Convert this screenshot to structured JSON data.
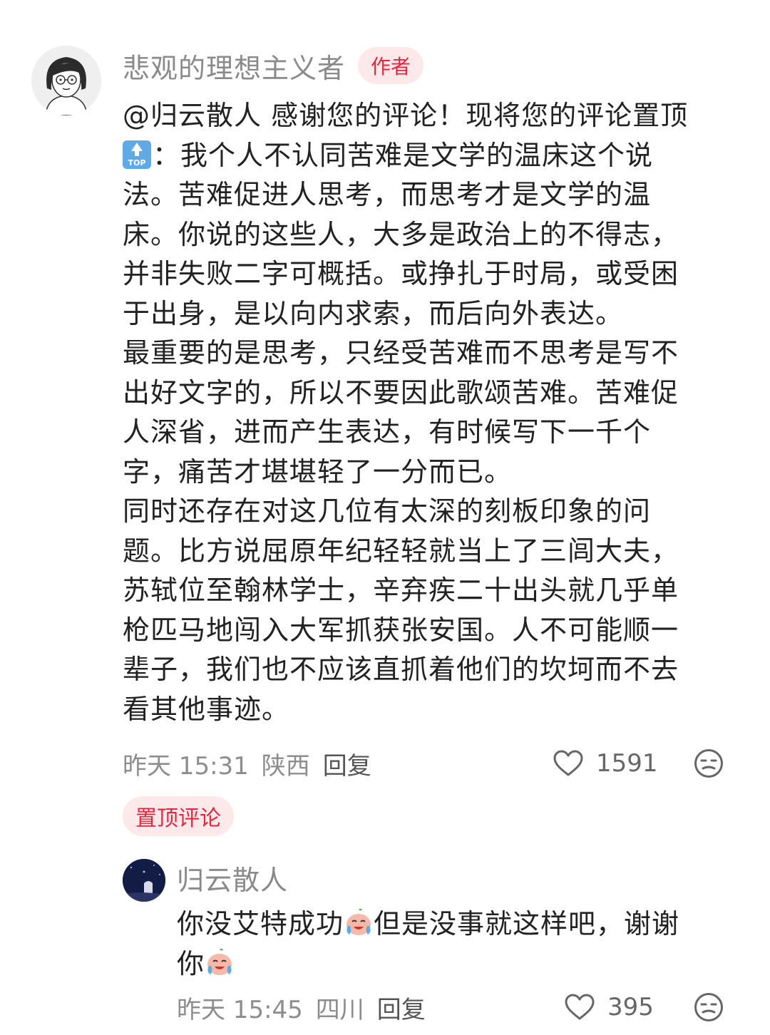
{
  "main_comment": {
    "author": "悲观的理想主义者",
    "author_badge": "作者",
    "avatar_icon": "girl-with-glasses-avatar",
    "text_lines": [
      "@归云散人 感谢您的评论！现将您的评论置顶",
      "：我个人不认同苦难是文学的温床这个说",
      "法。苦难促进人思考，而思考才是文学的温",
      "床。你说的这些人，大多是政治上的不得志，",
      "并非失败二字可概括。或挣扎于时局，或受困",
      "于出身，是以向内求索，而后向外表达。",
      "最重要的是思考，只经受苦难而不思考是写不",
      "出好文字的，所以不要因此歌颂苦难。苦难促",
      "人深省，进而产生表达，有时候写下一千个",
      "字，痛苦才堪堪轻了一分而已。",
      "同时还存在对这几位有太深的刻板印象的问",
      "题。比方说屈原年纪轻轻就当上了三闾大夫，",
      "苏轼位至翰林学士，辛弃疾二十出头就几乎单",
      "枪匹马地闯入大军抓获张安国。人不可能顺一",
      "辈子，我们也不应该直抓着他们的坎坷而不去",
      "看其他事迹。"
    ],
    "top_emoji_label": "TOP",
    "time": "昨天 15:31",
    "location": "陕西",
    "reply_label": "回复",
    "likes": "1591",
    "pinned_label": "置顶评论"
  },
  "reply_comment": {
    "author": "归云散人",
    "avatar_icon": "night-scene-avatar",
    "text_part1": "你没艾特成功",
    "text_part2": "但是没事就这样吧，谢谢",
    "text_part3": "你",
    "emoji_icon": "crying-face-emoji",
    "time": "昨天 15:45",
    "location": "四川",
    "reply_label": "回复",
    "likes": "395"
  },
  "colors": {
    "accent": "#e5263d",
    "badge_bg": "#fde8ea",
    "meta_text": "#8d8d8d",
    "body_text": "#222222"
  }
}
